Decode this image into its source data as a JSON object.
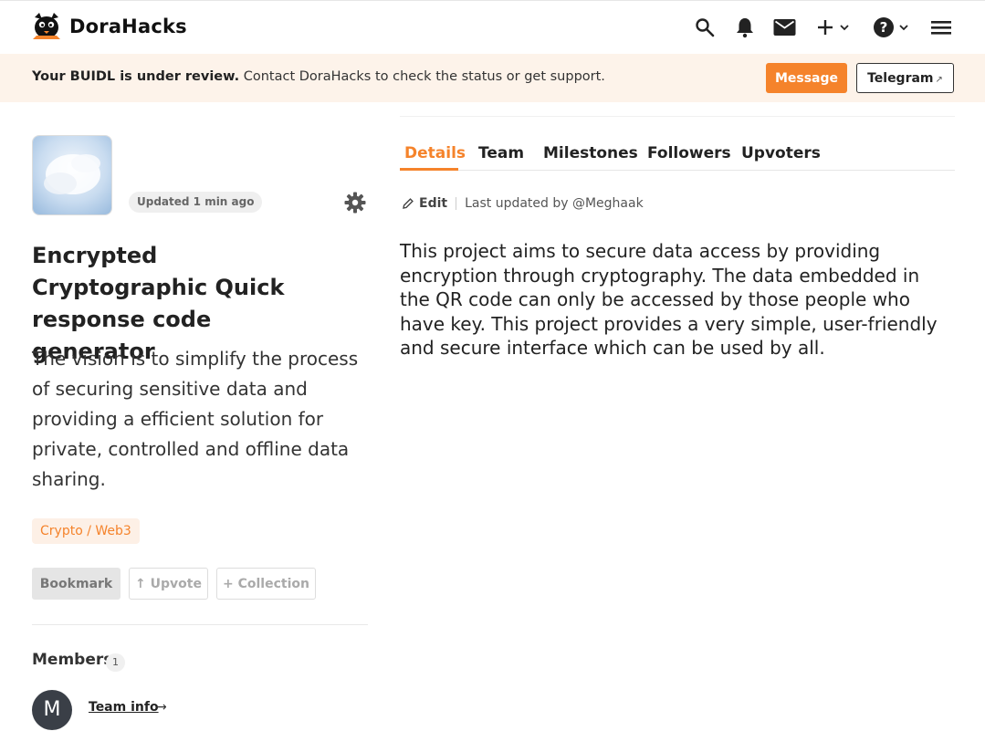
{
  "header": {
    "brand": "DoraHacks"
  },
  "banner": {
    "bold_text": "Your BUIDL is under review.",
    "text": "Contact DoraHacks to check the status or get support.",
    "message_label": "Message",
    "telegram_label": "Telegram",
    "telegram_arrow": "↗"
  },
  "project": {
    "updated_label": "Updated 1 min ago",
    "title": "Encrypted Cryptographic Quick response code generator",
    "vision": "The vision is to simplify the process of securing sensitive data and providing a efficient solution for private, controlled and offline data sharing.",
    "tag": "Crypto / Web3",
    "bookmark_label": "Bookmark",
    "upvote_label": "↑ Upvote",
    "collection_label": "+ Collection"
  },
  "members": {
    "title": "Members",
    "count": "1",
    "avatar_letter": "M",
    "team_info_label": "Team info",
    "team_info_arrow": "→"
  },
  "tabs": [
    {
      "label": "Details"
    },
    {
      "label": "Team"
    },
    {
      "label": "Milestones"
    },
    {
      "label": "Followers"
    },
    {
      "label": "Upvoters"
    }
  ],
  "details": {
    "edit_label": "Edit",
    "last_updated": "Last updated by @Meghaak",
    "body": "This project aims to secure data access by providing encryption through cryptography. The data embedded in the QR code can only be accessed by those people who have key. This project provides a very simple, user-friendly and secure interface which can be used by all."
  },
  "colors": {
    "accent": "#f5832b",
    "banner_bg": "#fdf3ea"
  }
}
